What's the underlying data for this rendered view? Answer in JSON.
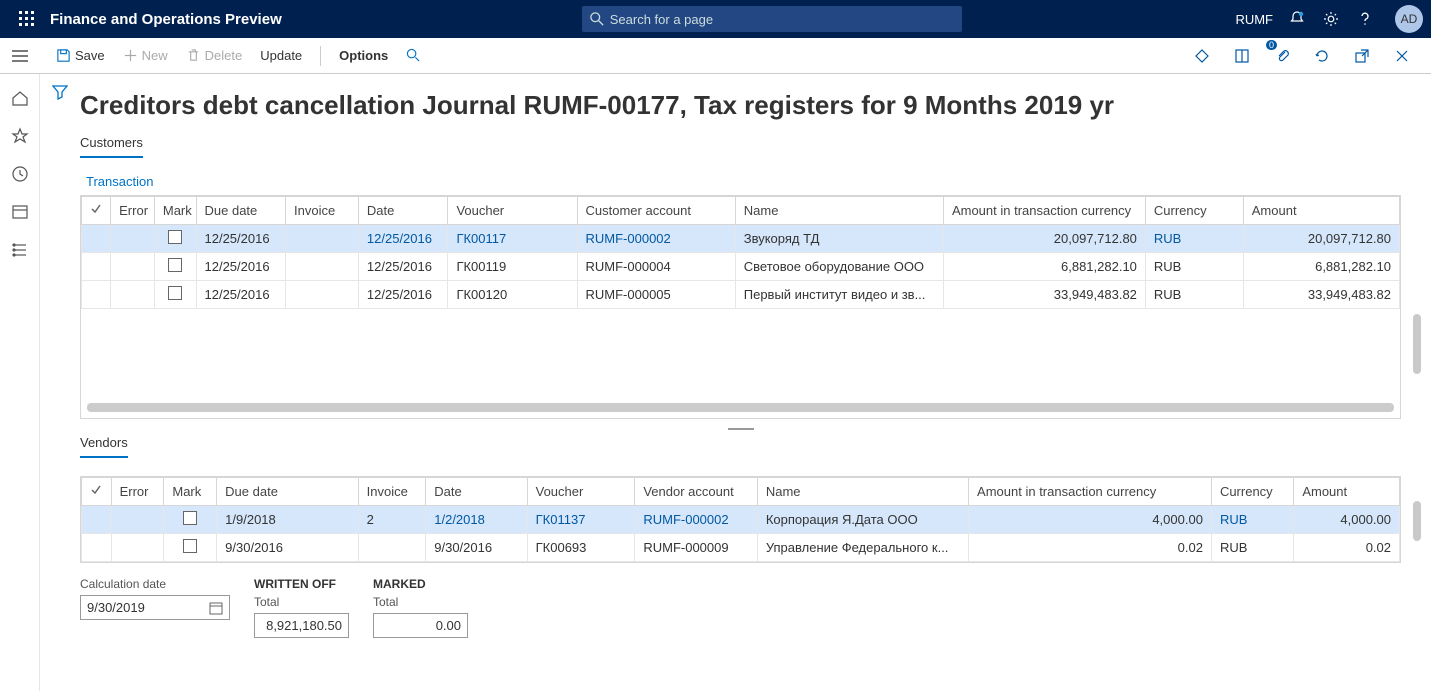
{
  "topbar": {
    "app_title": "Finance and Operations Preview",
    "search_placeholder": "Search for a page",
    "company": "RUMF",
    "avatar": "AD"
  },
  "cmdbar": {
    "save": "Save",
    "new": "New",
    "delete": "Delete",
    "update": "Update",
    "options": "Options",
    "attach_count": "0"
  },
  "page": {
    "title": "Creditors debt cancellation Journal RUMF-00177, Tax registers for 9 Months 2019 yr"
  },
  "customers": {
    "section": "Customers",
    "transaction": "Transaction",
    "headers": {
      "error": "Error",
      "mark": "Mark",
      "due_date": "Due date",
      "invoice": "Invoice",
      "date": "Date",
      "voucher": "Voucher",
      "account": "Customer account",
      "name": "Name",
      "amt_tc": "Amount in transaction currency",
      "currency": "Currency",
      "amount": "Amount"
    },
    "rows": [
      {
        "due_date": "12/25/2016",
        "invoice": "",
        "date": "12/25/2016",
        "voucher": "ГК00117",
        "account": "RUMF-000002",
        "name": "Звукоряд ТД",
        "amt_tc": "20,097,712.80",
        "currency": "RUB",
        "amount": "20,097,712.80"
      },
      {
        "due_date": "12/25/2016",
        "invoice": "",
        "date": "12/25/2016",
        "voucher": "ГК00119",
        "account": "RUMF-000004",
        "name": "Световое оборудование ООО",
        "amt_tc": "6,881,282.10",
        "currency": "RUB",
        "amount": "6,881,282.10"
      },
      {
        "due_date": "12/25/2016",
        "invoice": "",
        "date": "12/25/2016",
        "voucher": "ГК00120",
        "account": "RUMF-000005",
        "name": "Первый институт видео и зв...",
        "amt_tc": "33,949,483.82",
        "currency": "RUB",
        "amount": "33,949,483.82"
      }
    ]
  },
  "vendors": {
    "section": "Vendors",
    "headers": {
      "error": "Error",
      "mark": "Mark",
      "due_date": "Due date",
      "invoice": "Invoice",
      "date": "Date",
      "voucher": "Voucher",
      "account": "Vendor account",
      "name": "Name",
      "amt_tc": "Amount in transaction currency",
      "currency": "Currency",
      "amount": "Amount"
    },
    "rows": [
      {
        "due_date": "1/9/2018",
        "invoice": "2",
        "date": "1/2/2018",
        "voucher": "ГК01137",
        "account": "RUMF-000002",
        "name": "Корпорация Я.Дата ООО",
        "amt_tc": "4,000.00",
        "currency": "RUB",
        "amount": "4,000.00"
      },
      {
        "due_date": "9/30/2016",
        "invoice": "",
        "date": "9/30/2016",
        "voucher": "ГК00693",
        "account": "RUMF-000009",
        "name": "Управление Федерального к...",
        "amt_tc": "0.02",
        "currency": "RUB",
        "amount": "0.02"
      }
    ]
  },
  "footer": {
    "calc_date_label": "Calculation date",
    "calc_date_value": "9/30/2019",
    "written_off": "WRITTEN OFF",
    "marked": "MARKED",
    "total_label": "Total",
    "written_off_total": "8,921,180.50",
    "marked_total": "0.00"
  }
}
